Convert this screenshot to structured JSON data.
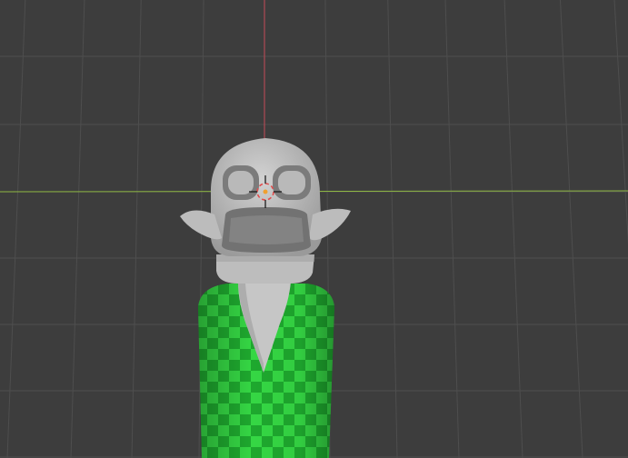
{
  "viewport": {
    "background": "#3d3d3d",
    "grid_color": "#4e4e4e",
    "axis_x_color": "#8fb844",
    "axis_z_color": "#c54b56"
  },
  "model": {
    "head_color": "#c2c2c2",
    "neck_color": "#bdbdbd",
    "body_color": "#35d744",
    "checker_dark": "#1ea82e",
    "vest_color": "#c6c6c6"
  },
  "cursor": {
    "ring_color": "#e24b4b"
  }
}
